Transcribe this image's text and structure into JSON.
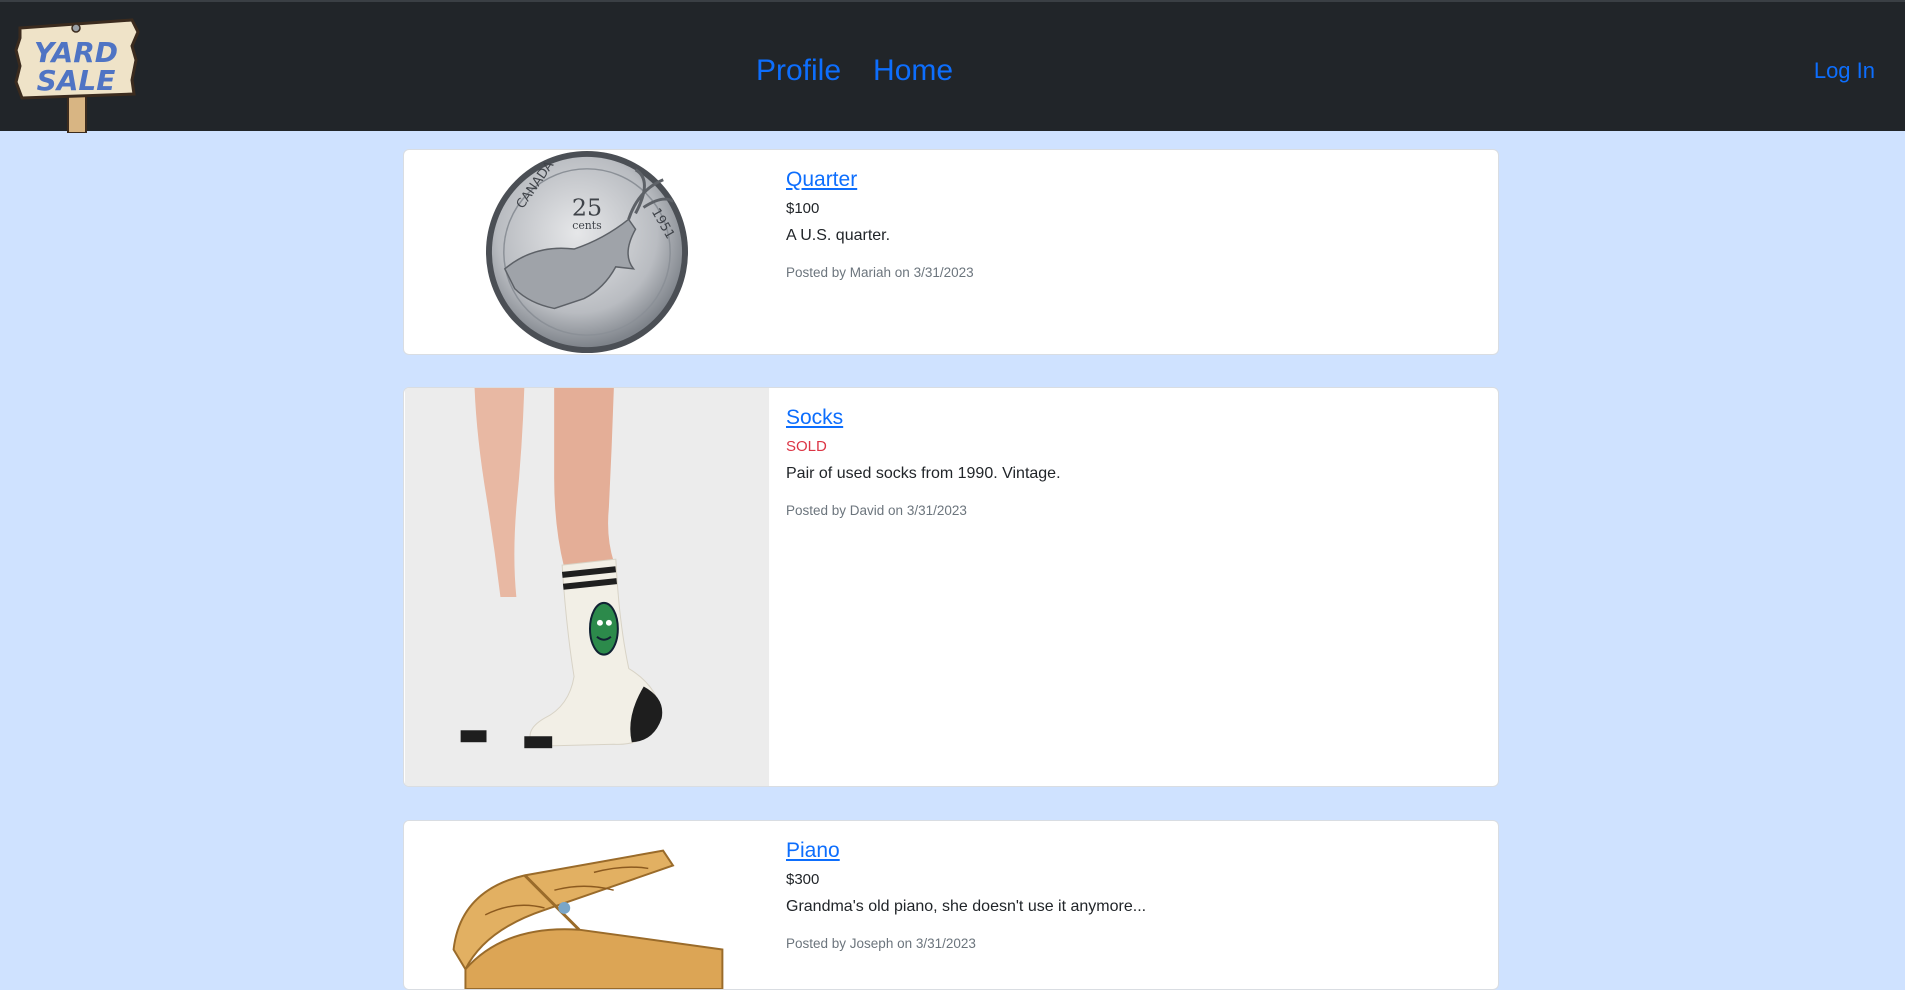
{
  "header": {
    "logo_text_line1": "YARD",
    "logo_text_line2": "SALE",
    "nav": [
      "Profile",
      "Home"
    ],
    "login_label": "Log In"
  },
  "listings": [
    {
      "title": "Quarter",
      "price": "$100",
      "description": "A U.S. quarter.",
      "posted": "Posted by Mariah on 3/31/2023",
      "coin_text": "25",
      "coin_text2": "cents",
      "coin_country": "CANADA",
      "coin_year": "1951"
    },
    {
      "title": "Socks",
      "status": "SOLD",
      "description": "Pair of used socks from 1990. Vintage.",
      "posted": "Posted by David on 3/31/2023"
    },
    {
      "title": "Piano",
      "price": "$300",
      "description": "Grandma's old piano, she doesn't use it anymore...",
      "posted": "Posted by Joseph on 3/31/2023"
    }
  ]
}
